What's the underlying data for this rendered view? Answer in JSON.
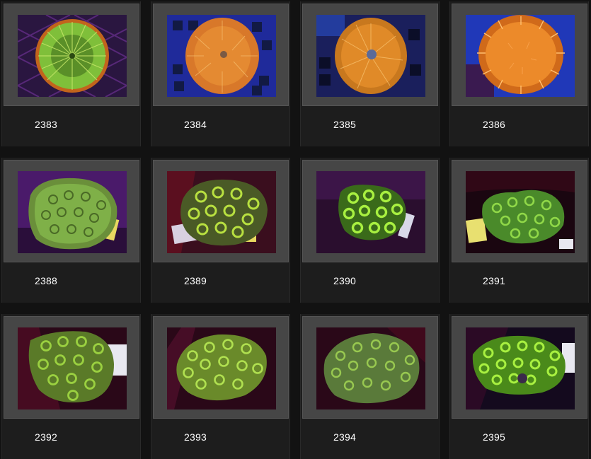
{
  "items": [
    {
      "id": "2383",
      "style": "mushroom-green"
    },
    {
      "id": "2384",
      "style": "orange-blue"
    },
    {
      "id": "2385",
      "style": "orange-dark"
    },
    {
      "id": "2386",
      "style": "orange-spiky"
    },
    {
      "id": "2388",
      "style": "brain-green"
    },
    {
      "id": "2389",
      "style": "brain-pink"
    },
    {
      "id": "2390",
      "style": "brain-bright"
    },
    {
      "id": "2391",
      "style": "brain-tag"
    },
    {
      "id": "2392",
      "style": "brain-green"
    },
    {
      "id": "2393",
      "style": "brain-pink"
    },
    {
      "id": "2394",
      "style": "brain-bright"
    },
    {
      "id": "2395",
      "style": "brain-tag"
    }
  ],
  "colors": {
    "background": "#121212",
    "card": "#1d1d1d",
    "frame": "#464646",
    "label": "#ffffff"
  }
}
